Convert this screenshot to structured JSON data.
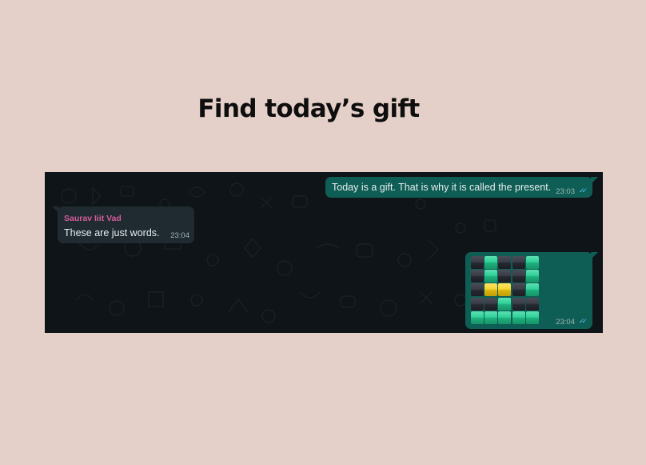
{
  "headline": "Find today’s gift",
  "chat": {
    "messages": [
      {
        "direction": "outgoing",
        "text": "Today is a gift. That is why it is called the present.",
        "time": "23:03",
        "status": "read"
      },
      {
        "direction": "incoming",
        "sender": "Saurav Iiit Vad",
        "text": "These are just words.",
        "time": "23:04"
      },
      {
        "direction": "outgoing",
        "type": "emoji-grid",
        "time": "23:04",
        "status": "read",
        "grid": [
          [
            "dark",
            "green",
            "dark",
            "dark",
            "green"
          ],
          [
            "dark",
            "green",
            "dark",
            "dark",
            "green"
          ],
          [
            "dark",
            "yellow",
            "yellow",
            "dark",
            "green"
          ],
          [
            "dark",
            "dark",
            "green",
            "dark",
            "dark"
          ],
          [
            "green",
            "green",
            "green",
            "green",
            "green"
          ]
        ]
      }
    ]
  },
  "colors": {
    "page_bg": "#e4d0c8",
    "chat_bg": "#0f1418",
    "outgoing_bubble": "#0f5e55",
    "incoming_bubble": "#1f2b31",
    "sender_name": "#d35c99",
    "read_ticks": "#53bdeb"
  },
  "icons": {
    "read_receipt": "double-check-icon"
  }
}
